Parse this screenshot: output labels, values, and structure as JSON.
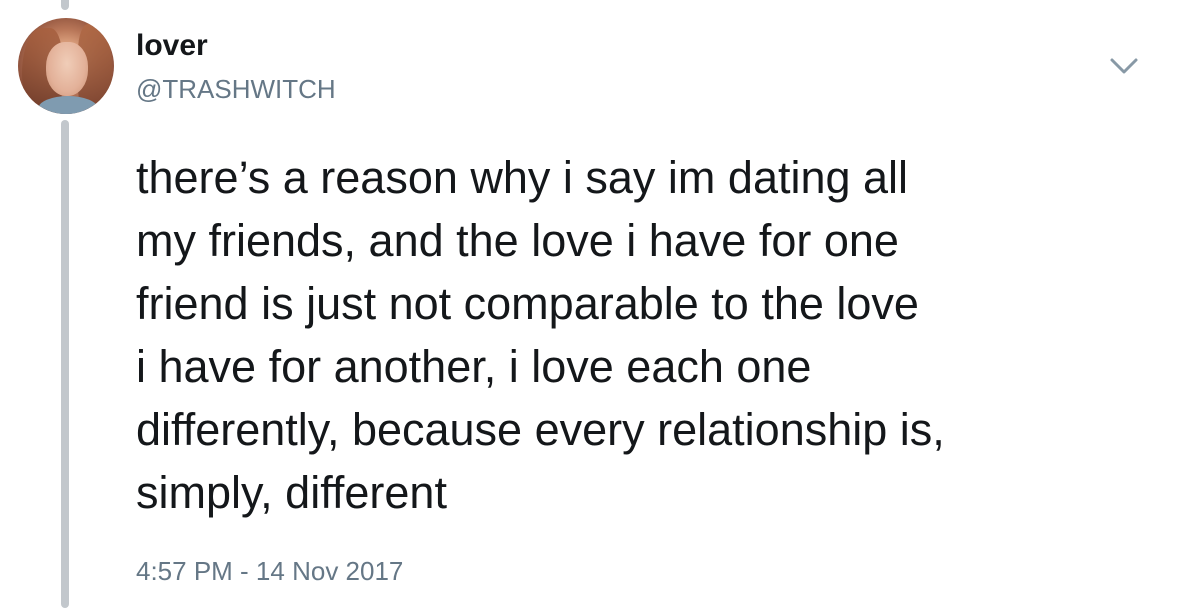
{
  "user": {
    "display_name": "lover",
    "handle": "@TRASHWITCH"
  },
  "tweet": {
    "text": "there’s a reason why i say im dating all\nmy friends, and the love i have for one\nfriend is just not comparable to the love\ni have for another, i love each one\ndifferently, because every relationship is,\nsimply, different",
    "timestamp": "4:57 PM - 14 Nov 2017"
  },
  "icons": {
    "menu": "chevron-down-icon",
    "avatar": "profile-photo"
  },
  "colors": {
    "text_primary": "#14171a",
    "text_secondary": "#657786",
    "thread_line": "#c2c7cc"
  }
}
